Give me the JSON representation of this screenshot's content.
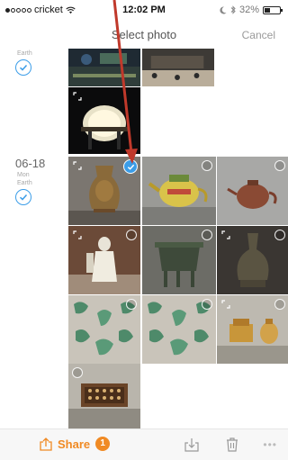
{
  "status": {
    "carrier": "cricket",
    "time": "12:02 PM",
    "battery": "32%"
  },
  "nav": {
    "title": "Select photo",
    "cancel": "Cancel"
  },
  "groups": [
    {
      "location": "Earth"
    },
    {
      "date": "06-18",
      "weekday": "Mon",
      "location": "Earth"
    }
  ],
  "toolbar": {
    "share_label": "Share",
    "share_count": "1",
    "more": "•••"
  },
  "colors": {
    "accent": "#f08a24",
    "check": "#3b9de8",
    "arrow": "#c0392b"
  },
  "icons": [
    "share-icon",
    "download-icon",
    "trash-icon",
    "more-icon",
    "check-icon",
    "expand-icon",
    "wifi-icon",
    "bluetooth-icon",
    "battery-icon"
  ]
}
